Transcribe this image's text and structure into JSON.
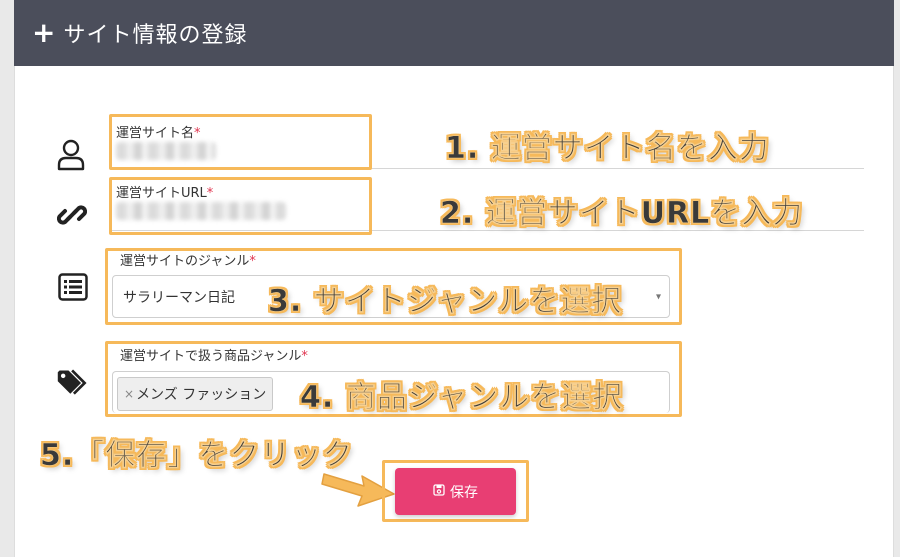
{
  "header": {
    "plus_icon": "plus-icon",
    "title": "サイト情報の登録"
  },
  "fields": {
    "site_name": {
      "label": "運営サイト名",
      "required_mark": "*",
      "icon": "user-icon"
    },
    "site_url": {
      "label": "運営サイトURL",
      "required_mark": "*",
      "icon": "link-icon"
    },
    "site_genre": {
      "label": "運営サイトのジャンル",
      "required_mark": "*",
      "icon": "list-icon",
      "selected": "サラリーマン日記",
      "caret": "▾"
    },
    "product_genre": {
      "label": "運営サイトで扱う商品ジャンル",
      "required_mark": "*",
      "icon": "tags-icon",
      "tag_remove": "×",
      "tag": "メンズ ファッション"
    }
  },
  "save_button": {
    "label": "保存",
    "icon": "save-icon"
  },
  "annotations": {
    "step1": "1. 運営サイト名を入力",
    "step2": "2. 運営サイトURLを入力",
    "step3": "3. サイトジャンルを選択",
    "step4": "4. 商品ジャンルを選択",
    "step5": "5.「保存」をクリック"
  },
  "colors": {
    "header_bg": "#4b4e5b",
    "accent": "#e83e73",
    "highlight": "#f6b95a",
    "required": "#e0334e"
  }
}
